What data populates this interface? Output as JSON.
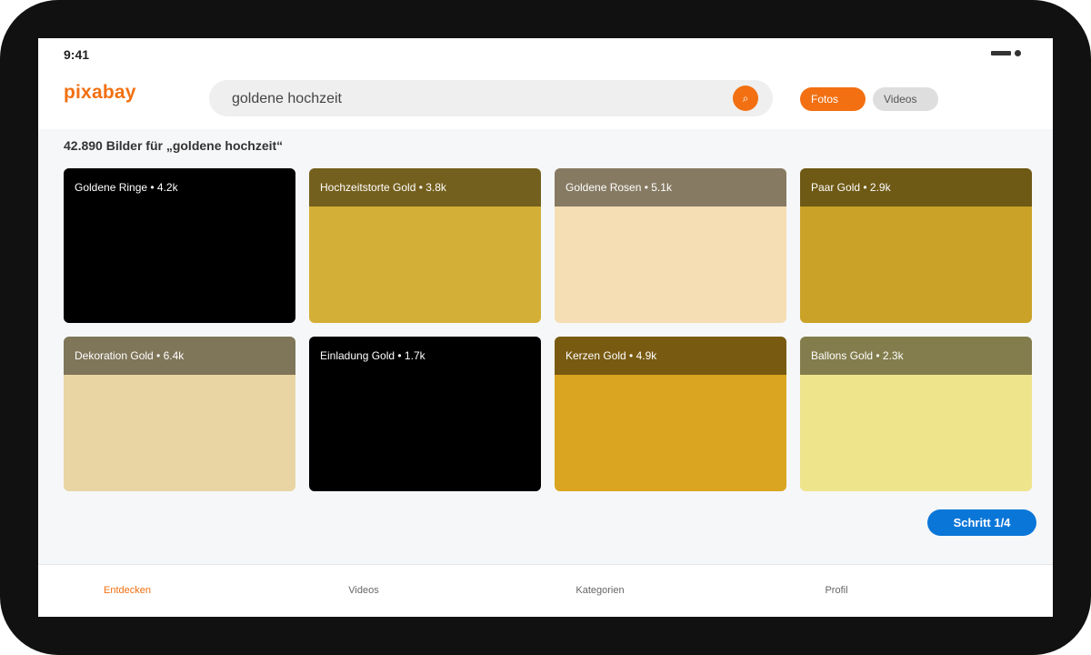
{
  "status_bar": {
    "time": "9:41"
  },
  "header": {
    "logo": "pixabay",
    "search": {
      "value": "goldene hochzeit",
      "button_icon": "search-icon"
    },
    "filters": [
      {
        "label": "Fotos",
        "active": true
      },
      {
        "label": "Videos",
        "active": false
      }
    ]
  },
  "results": {
    "count_text": "42.890 Bilder für „goldene hochzeit“",
    "cards": [
      {
        "label": "Goldene Ringe • 4.2k",
        "color": "#000000"
      },
      {
        "label": "Hochzeitstorte Gold • 3.8k",
        "color": "#d4af37"
      },
      {
        "label": "Goldene Rosen • 5.1k",
        "color": "#f5deb3"
      },
      {
        "label": "Paar Gold • 2.9k",
        "color": "#c9a227"
      },
      {
        "label": "Dekoration Gold • 6.4k",
        "color": "#e8d5a3"
      },
      {
        "label": "Einladung Gold • 1.7k",
        "color": "#000000"
      },
      {
        "label": "Kerzen Gold • 4.9k",
        "color": "#daa520"
      },
      {
        "label": "Ballons Gold • 2.3k",
        "color": "#eee48c"
      }
    ]
  },
  "step_button": {
    "label": "Schritt 1/4"
  },
  "bottom_nav": [
    {
      "label": "Entdecken",
      "active": true
    },
    {
      "label": "Videos",
      "active": false
    },
    {
      "label": "Kategorien",
      "active": false
    },
    {
      "label": "Profil",
      "active": false
    }
  ],
  "colors": {
    "accent": "#f27012",
    "primary_button": "#0a76d8"
  }
}
